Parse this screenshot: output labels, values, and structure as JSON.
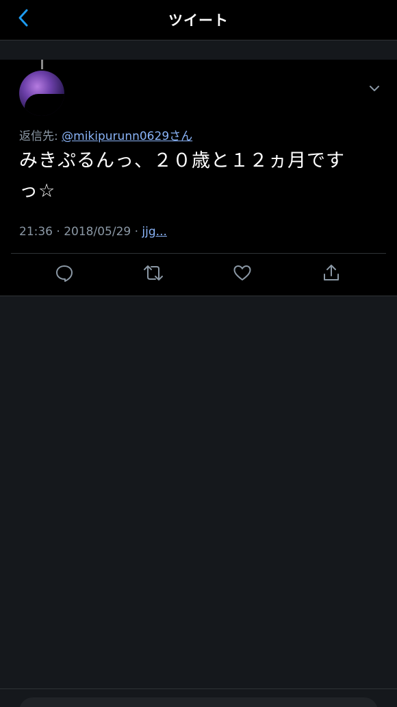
{
  "header": {
    "title": "ツイート",
    "back_icon": "chevron-left-icon"
  },
  "tweet": {
    "reply_label": "返信先: ",
    "reply_handle": "@mikipurunn0629さん",
    "text_line1": "みきぷるんっ、２０歳と１２ヵ月です",
    "text_line2": "っ☆",
    "time": "21:36",
    "separator": " · ",
    "date": "2018/05/29",
    "separator2": " · ",
    "source": "jjg..."
  },
  "actions": {
    "reply_icon": "comment-icon",
    "retweet_icon": "retweet-icon",
    "like_icon": "heart-icon",
    "share_icon": "share-icon"
  },
  "colors": {
    "background": "#000000",
    "empty_area": "#15181c",
    "link": "#8ab4f8",
    "secondary_text": "#8b98a5",
    "accent": "#1d9bf0"
  }
}
